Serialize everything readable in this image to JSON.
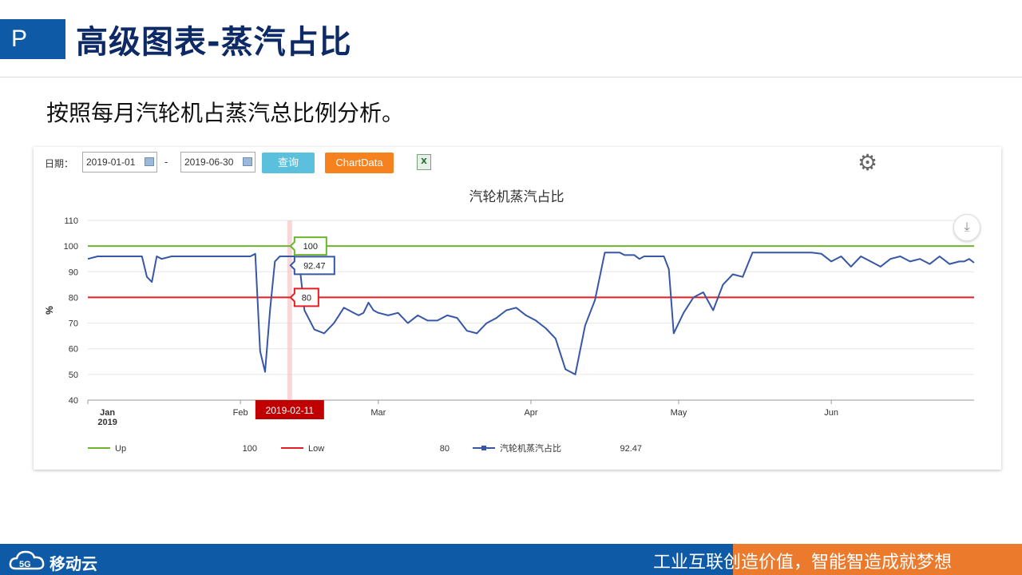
{
  "slide": {
    "tag": "P",
    "title": "高级图表-蒸汽占比",
    "subtitle": "按照每月汽轮机占蒸汽总比例分析。"
  },
  "toolbar": {
    "date_label": "日期：",
    "start_date": "2019-01-01",
    "separator": "-",
    "end_date": "2019-06-30",
    "query_label": "查询",
    "chartdata_label": "ChartData",
    "excel_icon": "excel-export-icon",
    "settings_icon": "gear-icon",
    "download_icon": "download-icon"
  },
  "colors": {
    "query_button": "#5bc0de",
    "chartdata_button": "#f5821f",
    "up_line": "#6cb52d",
    "low_line": "#e31e24",
    "series_line": "#3757a6",
    "crosshair": "#f7c6c7",
    "date_tag": "#c00000",
    "footer_blue": "#0e5aa7",
    "footer_orange": "#ec7a2d"
  },
  "chart_data": {
    "type": "line",
    "title": "汽轮机蒸汽占比",
    "ylabel": "%",
    "ylim": [
      40,
      110
    ],
    "yticks": [
      40,
      50,
      60,
      70,
      80,
      90,
      100,
      110
    ],
    "xlim": [
      "2019-01-01",
      "2019-06-30"
    ],
    "x_tick_labels": [
      {
        "date": "2019-01-05",
        "label": "Jan",
        "sublabel": "2019"
      },
      {
        "date": "2019-02-01",
        "label": "Feb"
      },
      {
        "date": "2019-03-01",
        "label": "Mar"
      },
      {
        "date": "2019-04-01",
        "label": "Apr"
      },
      {
        "date": "2019-05-01",
        "label": "May"
      },
      {
        "date": "2019-06-01",
        "label": "Jun"
      }
    ],
    "crosshair_date": "2019-02-11",
    "crosshair_values": {
      "Up": "100",
      "汽轮机蒸汽占比": "92.47",
      "Low": "80"
    },
    "legend": [
      {
        "name": "Up",
        "value": "100"
      },
      {
        "name": "Low",
        "value": "80"
      },
      {
        "name": "汽轮机蒸汽占比",
        "value": "92.47"
      }
    ],
    "series": [
      {
        "name": "Up",
        "constant": 100
      },
      {
        "name": "Low",
        "constant": 80
      },
      {
        "name": "汽轮机蒸汽占比",
        "x": [
          "2019-01-01",
          "2019-01-03",
          "2019-01-05",
          "2019-01-07",
          "2019-01-09",
          "2019-01-10",
          "2019-01-11",
          "2019-01-12",
          "2019-01-13",
          "2019-01-14",
          "2019-01-15",
          "2019-01-16",
          "2019-01-18",
          "2019-01-20",
          "2019-01-23",
          "2019-01-26",
          "2019-01-29",
          "2019-02-01",
          "2019-02-03",
          "2019-02-04",
          "2019-02-05",
          "2019-02-06",
          "2019-02-07",
          "2019-02-08",
          "2019-02-09",
          "2019-02-10",
          "2019-02-11",
          "2019-02-12",
          "2019-02-13",
          "2019-02-14",
          "2019-02-16",
          "2019-02-18",
          "2019-02-20",
          "2019-02-22",
          "2019-02-24",
          "2019-02-25",
          "2019-02-26",
          "2019-02-27",
          "2019-02-28",
          "2019-03-01",
          "2019-03-03",
          "2019-03-05",
          "2019-03-07",
          "2019-03-09",
          "2019-03-11",
          "2019-03-13",
          "2019-03-15",
          "2019-03-17",
          "2019-03-19",
          "2019-03-21",
          "2019-03-23",
          "2019-03-25",
          "2019-03-27",
          "2019-03-29",
          "2019-03-31",
          "2019-04-02",
          "2019-04-04",
          "2019-04-06",
          "2019-04-08",
          "2019-04-10",
          "2019-04-12",
          "2019-04-14",
          "2019-04-16",
          "2019-04-18",
          "2019-04-19",
          "2019-04-20",
          "2019-04-21",
          "2019-04-22",
          "2019-04-23",
          "2019-04-24",
          "2019-04-25",
          "2019-04-26",
          "2019-04-27",
          "2019-04-28",
          "2019-04-29",
          "2019-04-30",
          "2019-05-02",
          "2019-05-04",
          "2019-05-06",
          "2019-05-08",
          "2019-05-10",
          "2019-05-12",
          "2019-05-14",
          "2019-05-16",
          "2019-05-18",
          "2019-05-20",
          "2019-05-22",
          "2019-05-24",
          "2019-05-26",
          "2019-05-28",
          "2019-05-30",
          "2019-06-01",
          "2019-06-03",
          "2019-06-05",
          "2019-06-07",
          "2019-06-09",
          "2019-06-11",
          "2019-06-13",
          "2019-06-15",
          "2019-06-17",
          "2019-06-19",
          "2019-06-21",
          "2019-06-23",
          "2019-06-25",
          "2019-06-27",
          "2019-06-28",
          "2019-06-29",
          "2019-06-30"
        ],
        "y": [
          95,
          96,
          96,
          96,
          96,
          96,
          96,
          96,
          88,
          86,
          96,
          95,
          96,
          96,
          96,
          96,
          96,
          96,
          96,
          97,
          59,
          51,
          75,
          94,
          96,
          96,
          96,
          96,
          92.5,
          75,
          67.5,
          66,
          70,
          76,
          74,
          73,
          74,
          78,
          75,
          74,
          73,
          74,
          70,
          73,
          71,
          71,
          73,
          72,
          67,
          66,
          70,
          72,
          75,
          76,
          73,
          71,
          68,
          64,
          52,
          50,
          69,
          79,
          97.5,
          97.5,
          97.5,
          96.5,
          96.5,
          96.5,
          95,
          96,
          96,
          96,
          96,
          96,
          91,
          66,
          74,
          80,
          82,
          75,
          85,
          89,
          88,
          97.5,
          97.5,
          97.5,
          97.5,
          97.5,
          97.5,
          97.5,
          97,
          94,
          96,
          92,
          96,
          94,
          92,
          95,
          96,
          94,
          95,
          93,
          96,
          93,
          94,
          94,
          95,
          93.5
        ]
      }
    ]
  },
  "footer": {
    "logo_text": "移动云",
    "slogan": "工业互联创造价值，智能智造成就梦想"
  }
}
